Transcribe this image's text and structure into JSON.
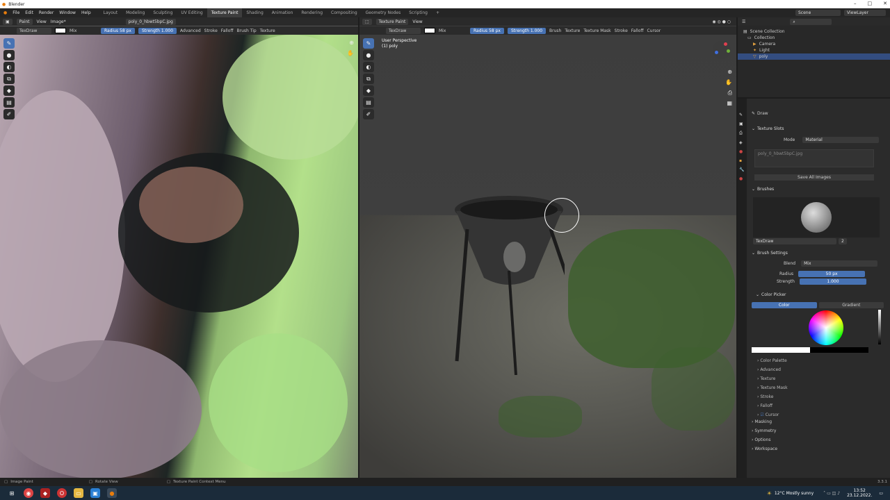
{
  "titlebar": {
    "title": "Blender"
  },
  "menu": {
    "items": [
      "File",
      "Edit",
      "Render",
      "Window",
      "Help"
    ],
    "workspaces": [
      "Layout",
      "Modeling",
      "Sculpting",
      "UV Editing",
      "Texture Paint",
      "Shading",
      "Animation",
      "Rendering",
      "Compositing",
      "Geometry Nodes",
      "Scripting",
      "+"
    ],
    "scene": "Scene",
    "view_layer": "ViewLayer"
  },
  "left": {
    "mode": "Paint",
    "view": "View",
    "image": "Image*",
    "image_name": "poly_0_hbwt5bpC.jpg",
    "brush": "TexDraw",
    "blend": "Mix",
    "radius_label": "Radius",
    "radius": "58 px",
    "strength_label": "Strength",
    "strength": "1.000",
    "menus": [
      "Advanced",
      "Stroke",
      "Falloff",
      "Brush Tip",
      "Texture"
    ]
  },
  "right": {
    "mode": "Texture Paint",
    "view": "View",
    "brush": "TexDraw",
    "blend": "Mix",
    "radius_label": "Radius",
    "radius": "58 px",
    "strength_label": "Strength",
    "strength": "1.000",
    "menus": [
      "Brush",
      "Texture",
      "Texture Mask",
      "Stroke",
      "Falloff",
      "Cursor"
    ],
    "overlay_line1": "User Perspective",
    "overlay_line2": "(1) poly"
  },
  "outliner": {
    "root": "Scene Collection",
    "collection": "Collection",
    "items": [
      "Camera",
      "Light",
      "poly"
    ]
  },
  "props": {
    "tool": "Draw",
    "texture_slots": "Texture Slots",
    "mode_label": "Mode",
    "mode": "Material",
    "slot": "poly_0_hbwt5bpC.jpg",
    "save_all": "Save All Images",
    "brushes": "Brushes",
    "brush_name": "TexDraw",
    "brush_users": "2",
    "brush_settings": "Brush Settings",
    "blend_label": "Blend",
    "blend": "Mix",
    "radius_label": "Radius",
    "radius": "50 px",
    "strength_label": "Strength",
    "strength": "1.000",
    "color_picker": "Color Picker",
    "tab_color": "Color",
    "tab_gradient": "Gradient",
    "subpanels": [
      "Color Palette",
      "Advanced",
      "Texture",
      "Texture Mask",
      "Stroke",
      "Falloff",
      "Cursor"
    ],
    "panels": [
      "Masking",
      "Symmetry",
      "Options",
      "Workspace"
    ]
  },
  "status": {
    "left": "Image Paint",
    "mid": "Rotate View",
    "right": "Texture Paint Context Menu",
    "version": "3.3.1"
  },
  "taskbar": {
    "weather": "12°C  Mostly sunny",
    "time": "13:52",
    "date": "23.12.2022."
  },
  "colors": {
    "accent": "#4772b3",
    "selected": "#334d80"
  }
}
